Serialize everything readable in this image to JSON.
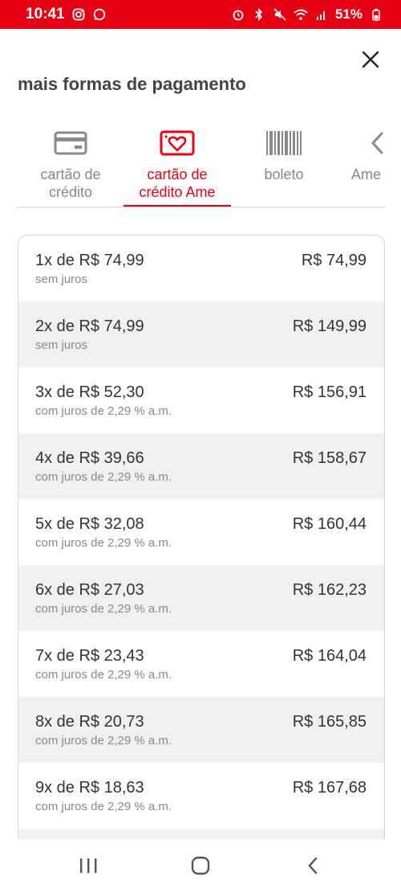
{
  "status_bar": {
    "time": "10:41",
    "battery": "51%",
    "color": "#e60014"
  },
  "sheet": {
    "title": "mais formas de pagamento",
    "close_icon": "close-icon"
  },
  "tabs": [
    {
      "line1": "cartão de",
      "line2": "crédito",
      "icon": "credit-card-icon",
      "active": false
    },
    {
      "line1": "cartão de",
      "line2": "crédito Ame",
      "icon": "ame-card-icon",
      "active": true
    },
    {
      "line1": "boleto",
      "line2": "",
      "icon": "barcode-icon",
      "active": false
    },
    {
      "line1": "Ame",
      "line2": "",
      "icon": "ame-icon",
      "active": false
    }
  ],
  "installments": [
    {
      "label": "1x de R$ 74,99",
      "note": "sem juros",
      "total": "R$ 74,99"
    },
    {
      "label": "2x de R$ 74,99",
      "note": "sem juros",
      "total": "R$ 149,99"
    },
    {
      "label": "3x de R$ 52,30",
      "note": "com juros de 2,29 % a.m.",
      "total": "R$ 156,91"
    },
    {
      "label": "4x de R$ 39,66",
      "note": "com juros de 2,29 % a.m.",
      "total": "R$ 158,67"
    },
    {
      "label": "5x de R$ 32,08",
      "note": "com juros de 2,29 % a.m.",
      "total": "R$ 160,44"
    },
    {
      "label": "6x de R$ 27,03",
      "note": "com juros de 2,29 % a.m.",
      "total": "R$ 162,23"
    },
    {
      "label": "7x de R$ 23,43",
      "note": "com juros de 2,29 % a.m.",
      "total": "R$ 164,04"
    },
    {
      "label": "8x de R$ 20,73",
      "note": "com juros de 2,29 % a.m.",
      "total": "R$ 165,85"
    },
    {
      "label": "9x de R$ 18,63",
      "note": "com juros de 2,29 % a.m.",
      "total": "R$ 167,68"
    }
  ],
  "colors": {
    "accent": "#e60014",
    "row_shade": "#f0f0f0",
    "muted_text": "#8a8a8a"
  }
}
